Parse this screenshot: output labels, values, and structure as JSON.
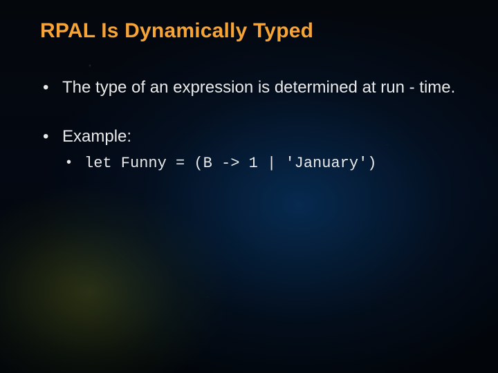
{
  "title": "RPAL Is Dynamically Typed",
  "bullets": {
    "b1": "The type of an expression  is determined at run - time.",
    "b2": "Example:",
    "b2_sub1": "let Funny = (B -> 1 | 'January')"
  }
}
